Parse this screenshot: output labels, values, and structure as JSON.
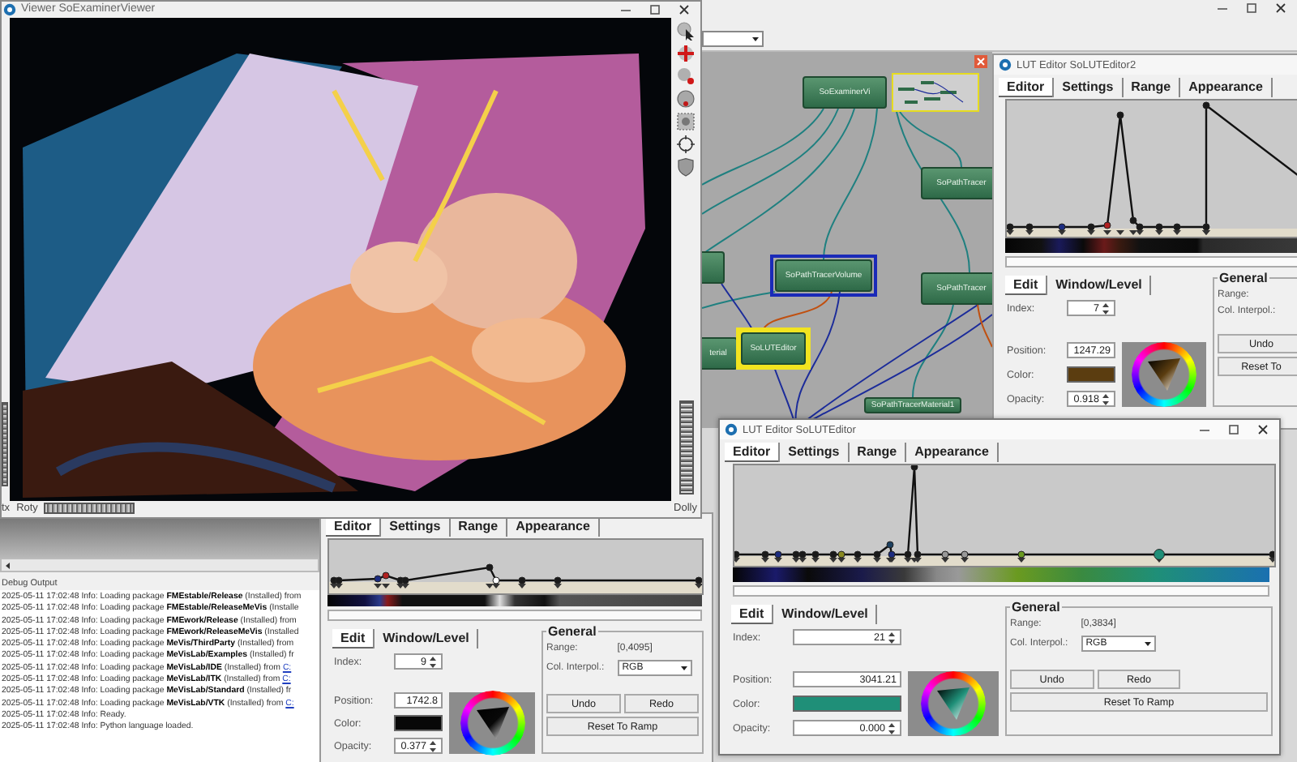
{
  "viewer": {
    "title": "Viewer SoExaminerViewer",
    "rotx_label": "tx",
    "roty_label": "Roty",
    "dolly_label": "Dolly"
  },
  "network": {
    "nodes": [
      {
        "label": "SoExaminerVi",
        "selected": false,
        "highlighted": false
      },
      {
        "label": "SoPathTracer",
        "selected": false,
        "highlighted": false
      },
      {
        "selected": false,
        "highlighted": false
      },
      {
        "label": "SoPathTracerVolume",
        "selected": true,
        "highlighted": false
      },
      {
        "label": "SoPathTracer",
        "selected": false,
        "highlighted": false
      },
      {
        "label": "terial",
        "selected": false,
        "highlighted": false
      },
      {
        "label": "SoLUTEditor",
        "selected": false,
        "highlighted": true
      },
      {
        "label": "SoPathTracerMaterial1",
        "selected": false,
        "highlighted": false
      }
    ]
  },
  "lut_editors": [
    {
      "title": "LUT Editor SoLUTEditor2",
      "window_controls": false,
      "tabs": [
        {
          "label": "Editor",
          "selected": true
        },
        {
          "label": "Settings",
          "selected": false
        },
        {
          "label": "Range",
          "selected": false
        },
        {
          "label": "Appearance",
          "selected": false
        }
      ],
      "edit_tabs": [
        {
          "label": "Edit",
          "selected": true
        },
        {
          "label": "Window/Level",
          "selected": false
        }
      ],
      "fields": [
        {
          "kind": "spin",
          "label": "Index:",
          "value": "7"
        },
        {
          "kind": "text",
          "label": "Position:",
          "value": "1247.29"
        },
        {
          "kind": "color",
          "label": "Color:",
          "color": "#5b3d10"
        },
        {
          "kind": "spin",
          "label": "Opacity:",
          "value": "0.918"
        }
      ],
      "general": {
        "title": "General",
        "range_label": "Range:",
        "interp_label": "Col. Interpol.:",
        "buttons": [
          {
            "kind": "undo",
            "label": "Undo"
          },
          {
            "kind": "reset",
            "label": "Reset To"
          }
        ]
      }
    },
    {
      "tabs": [
        {
          "label": "Editor",
          "selected": true
        },
        {
          "label": "Settings",
          "selected": false
        },
        {
          "label": "Range",
          "selected": false
        },
        {
          "label": "Appearance",
          "selected": false
        }
      ],
      "edit_tabs": [
        {
          "label": "Edit",
          "selected": true
        },
        {
          "label": "Window/Level",
          "selected": false
        }
      ],
      "fields": [
        {
          "kind": "spin",
          "label": "Index:",
          "value": "9"
        },
        {
          "kind": "text",
          "label": "Position:",
          "value": "1742.8"
        },
        {
          "kind": "color",
          "label": "Color:",
          "color": "#080808"
        },
        {
          "kind": "spin",
          "label": "Opacity:",
          "value": "0.377"
        }
      ],
      "general": {
        "title": "General",
        "range_label": "Range:",
        "range": "[0,4095]",
        "interp_label": "Col. Interpol.:",
        "interp": "RGB",
        "buttons": [
          {
            "kind": "undo",
            "label": "Undo"
          },
          {
            "kind": "redo",
            "label": "Redo"
          },
          {
            "kind": "reset",
            "label": "Reset To Ramp"
          }
        ]
      }
    },
    {
      "title": "LUT Editor SoLUTEditor",
      "window_controls": true,
      "tabs": [
        {
          "label": "Editor",
          "selected": true
        },
        {
          "label": "Settings",
          "selected": false
        },
        {
          "label": "Range",
          "selected": false
        },
        {
          "label": "Appearance",
          "selected": false
        }
      ],
      "edit_tabs": [
        {
          "label": "Edit",
          "selected": true
        },
        {
          "label": "Window/Level",
          "selected": false
        }
      ],
      "fields": [
        {
          "kind": "spin",
          "label": "Index:",
          "value": "21"
        },
        {
          "kind": "text",
          "label": "Position:",
          "value": "3041.21"
        },
        {
          "kind": "color",
          "label": "Color:",
          "color": "#1f8f78"
        },
        {
          "kind": "spin",
          "label": "Opacity:",
          "value": "0.000"
        }
      ],
      "general": {
        "title": "General",
        "range_label": "Range:",
        "range": "[0,3834]",
        "interp_label": "Col. Interpol.:",
        "interp": "RGB",
        "buttons": [
          {
            "kind": "undo",
            "label": "Undo"
          },
          {
            "kind": "redo",
            "label": "Redo"
          },
          {
            "kind": "reset",
            "label": "Reset To Ramp"
          }
        ]
      }
    }
  ],
  "debug": {
    "title": "Debug Output",
    "lines": [
      {
        "text": "2025-05-11 17:02:48 Info: Loading package **FMEstable/Release** (Installed) from"
      },
      {
        "text": "2025-05-11 17:02:48 Info: Loading package **FMEstable/ReleaseMeVis** (Installe"
      },
      {
        "text": "2025-05-11 17:02:48 Info: Loading package **FMEwork/Release** (Installed) from"
      },
      {
        "text": "2025-05-11 17:02:48 Info: Loading package **FMEwork/ReleaseMeVis** (Installed"
      },
      {
        "text": "2025-05-11 17:02:48 Info: Loading package **MeVis/ThirdParty** (Installed) from"
      },
      {
        "text": "2025-05-11 17:02:48 Info: Loading package **MeVisLab/Examples** (Installed) fr"
      },
      {
        "text": "2025-05-11 17:02:48 Info: Loading package **MeVisLab/IDE** (Installed) from",
        "link": "C:"
      },
      {
        "text": "2025-05-11 17:02:48 Info: Loading package **MeVisLab/ITK** (Installed) from",
        "link": "C:"
      },
      {
        "text": "2025-05-11 17:02:48 Info: Loading package **MeVisLab/Standard** (Installed) fr"
      },
      {
        "text": "2025-05-11 17:02:48 Info: Loading package **MeVisLab/VTK** (Installed) from",
        "link": "C:"
      },
      {
        "text": "2025-05-11 17:02:48 Info: Ready."
      },
      {
        "text": "2025-05-11 17:02:48 Info: Python language loaded."
      }
    ]
  }
}
